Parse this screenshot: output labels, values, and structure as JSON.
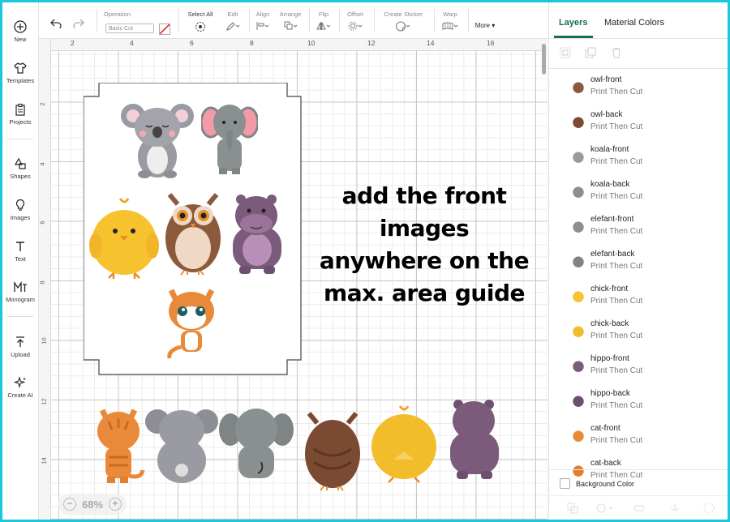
{
  "sidebar": {
    "items": [
      {
        "label": "New",
        "icon": "plus-circle-icon"
      },
      {
        "label": "Templates",
        "icon": "shirt-icon"
      },
      {
        "label": "Projects",
        "icon": "clipboard-icon"
      },
      {
        "label": "Shapes",
        "icon": "shapes-icon"
      },
      {
        "label": "Images",
        "icon": "lightbulb-icon"
      },
      {
        "label": "Text",
        "icon": "text-icon"
      },
      {
        "label": "Monogram",
        "icon": "monogram-icon"
      },
      {
        "label": "Upload",
        "icon": "upload-icon"
      },
      {
        "label": "Create AI",
        "icon": "sparkle-icon"
      }
    ]
  },
  "toolbar": {
    "operation_label": "Operation",
    "operation_value": "Basic Cut",
    "select_all_label": "Select All",
    "edit_label": "Edit",
    "align_label": "Align",
    "arrange_label": "Arrange",
    "flip_label": "Flip",
    "offset_label": "Offset",
    "create_sticker_label": "Create Sticker",
    "warp_label": "Warp",
    "more_label": "More ▾"
  },
  "canvas": {
    "ruler_top": [
      "2",
      "4",
      "6",
      "8",
      "10",
      "12",
      "14",
      "16"
    ],
    "ruler_left": [
      "2",
      "4",
      "6",
      "8",
      "10",
      "12",
      "14"
    ],
    "instruction_lines": [
      "add the front images",
      "anywhere on the",
      "max. area guide"
    ],
    "zoom": "68%",
    "zoom_out": "−",
    "zoom_in": "+"
  },
  "panel": {
    "tabs": [
      "Layers",
      "Material Colors"
    ],
    "layers": [
      {
        "name": "owl-front",
        "type": "Print Then Cut",
        "color": "#8b5a3c"
      },
      {
        "name": "owl-back",
        "type": "Print Then Cut",
        "color": "#7a4a33"
      },
      {
        "name": "koala-front",
        "type": "Print Then Cut",
        "color": "#9a9aa3"
      },
      {
        "name": "koala-back",
        "type": "Print Then Cut",
        "color": "#8d8d96"
      },
      {
        "name": "elefant-front",
        "type": "Print Then Cut",
        "color": "#8a9090"
      },
      {
        "name": "elefant-back",
        "type": "Print Then Cut",
        "color": "#7f8585"
      },
      {
        "name": "chick-front",
        "type": "Print Then Cut",
        "color": "#f6c22e"
      },
      {
        "name": "chick-back",
        "type": "Print Then Cut",
        "color": "#f2bd2a"
      },
      {
        "name": "hippo-front",
        "type": "Print Then Cut",
        "color": "#7b5a7c"
      },
      {
        "name": "hippo-back",
        "type": "Print Then Cut",
        "color": "#6f4f71"
      },
      {
        "name": "cat-front",
        "type": "Print Then Cut",
        "color": "#e98a3a"
      },
      {
        "name": "cat-back",
        "type": "Print Then Cut",
        "color": "#e3802f"
      }
    ],
    "background_color_label": "Background Color"
  }
}
